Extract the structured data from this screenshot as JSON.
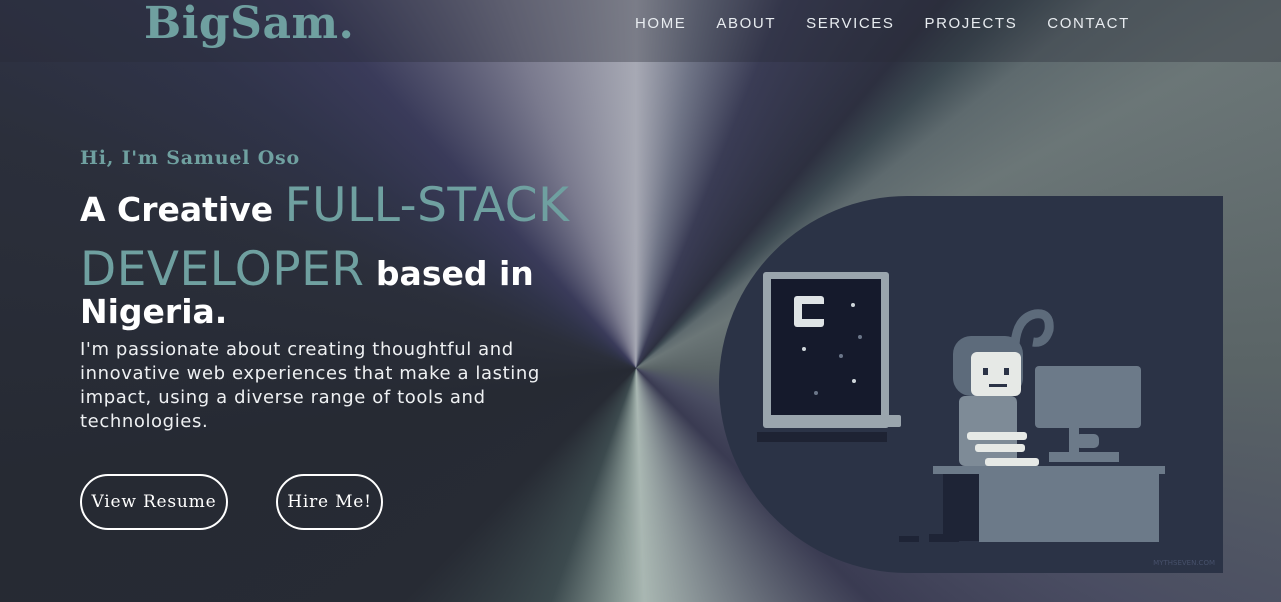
{
  "brand": {
    "logo": "BigSam."
  },
  "nav": {
    "items": [
      "HOME",
      "ABOUT",
      "SERVICES",
      "PROJECTS",
      "CONTACT"
    ]
  },
  "hero": {
    "greeting": "Hi, I'm Samuel Oso",
    "headline": {
      "part1": "A Creative ",
      "highlight1": "FULL-STACK",
      "highlight2": "DEVELOPER",
      "part2": " based in",
      "part3": "Nigeria."
    },
    "description": "I'm passionate about creating thoughtful and innovative web experiences that make a lasting impact, using a diverse range of tools and technologies.",
    "buttons": {
      "resume": "View Resume",
      "hire": "Hire Me!"
    },
    "illustration": {
      "watermark": "MYTHSEVEN.COM"
    }
  },
  "colors": {
    "accent": "#6fa0a0",
    "text": "#ffffff",
    "art_bg": "#2b3346"
  }
}
